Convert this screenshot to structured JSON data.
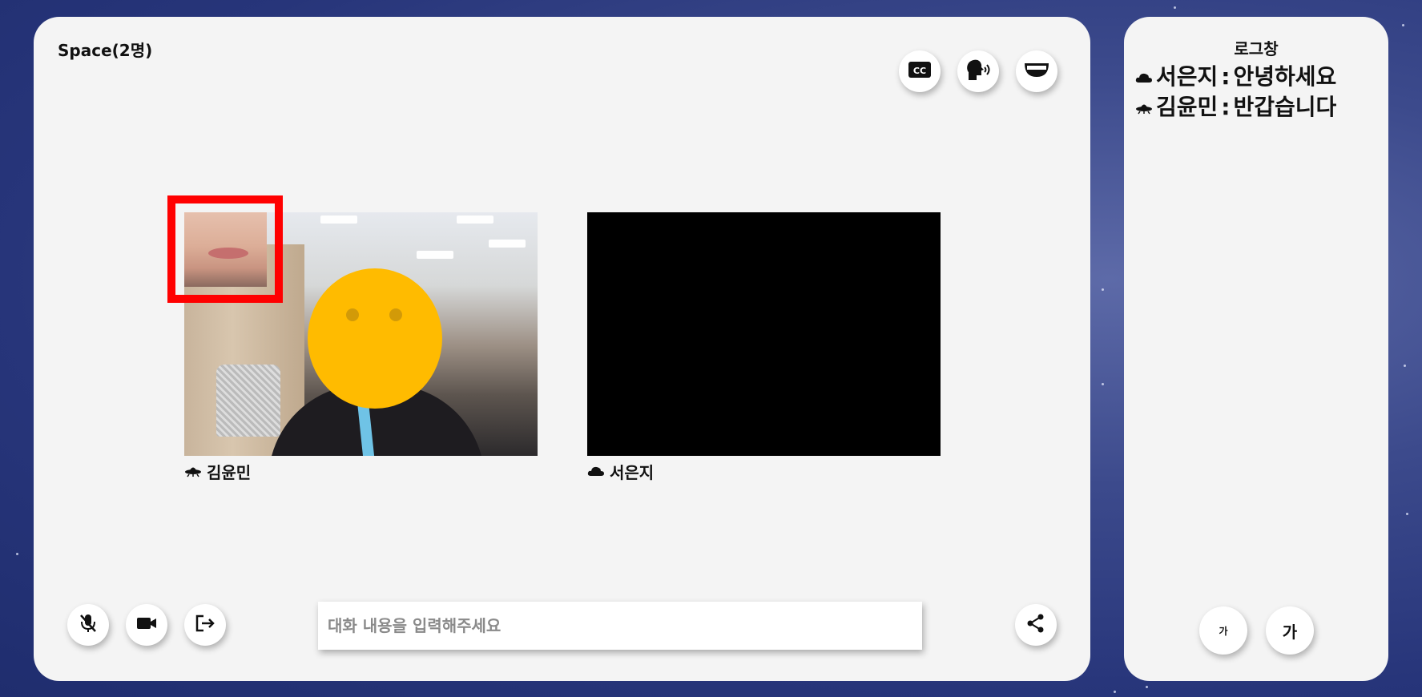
{
  "space": {
    "title": "Space(2명)"
  },
  "toolbar_top": {
    "subtitles_icon": "cc-icon",
    "speech_icon": "speaking-head-icon",
    "emotion_icon": "smile-mouth-icon"
  },
  "participants": [
    {
      "name": "김윤민",
      "icon": "ufo-icon"
    },
    {
      "name": "서은지",
      "icon": "cloud-icon"
    }
  ],
  "controls": {
    "mic_icon": "mic-off-icon",
    "camera_icon": "video-camera-icon",
    "exit_icon": "exit-icon",
    "share_icon": "share-icon"
  },
  "chat": {
    "placeholder": "대화 내용을 입력해주세요"
  },
  "log": {
    "title": "로그창",
    "entries": [
      {
        "icon": "cloud-icon",
        "name": "서은지",
        "separator": ":",
        "message": "안녕하세요"
      },
      {
        "icon": "ufo-icon",
        "name": "김윤민",
        "separator": ":",
        "message": "반갑습니다"
      }
    ],
    "font_small_label": "가",
    "font_large_label": "가"
  },
  "colors": {
    "highlight_frame": "#ff0000",
    "face_cover": "#ffbb00",
    "panel": "#f4f4f4"
  }
}
